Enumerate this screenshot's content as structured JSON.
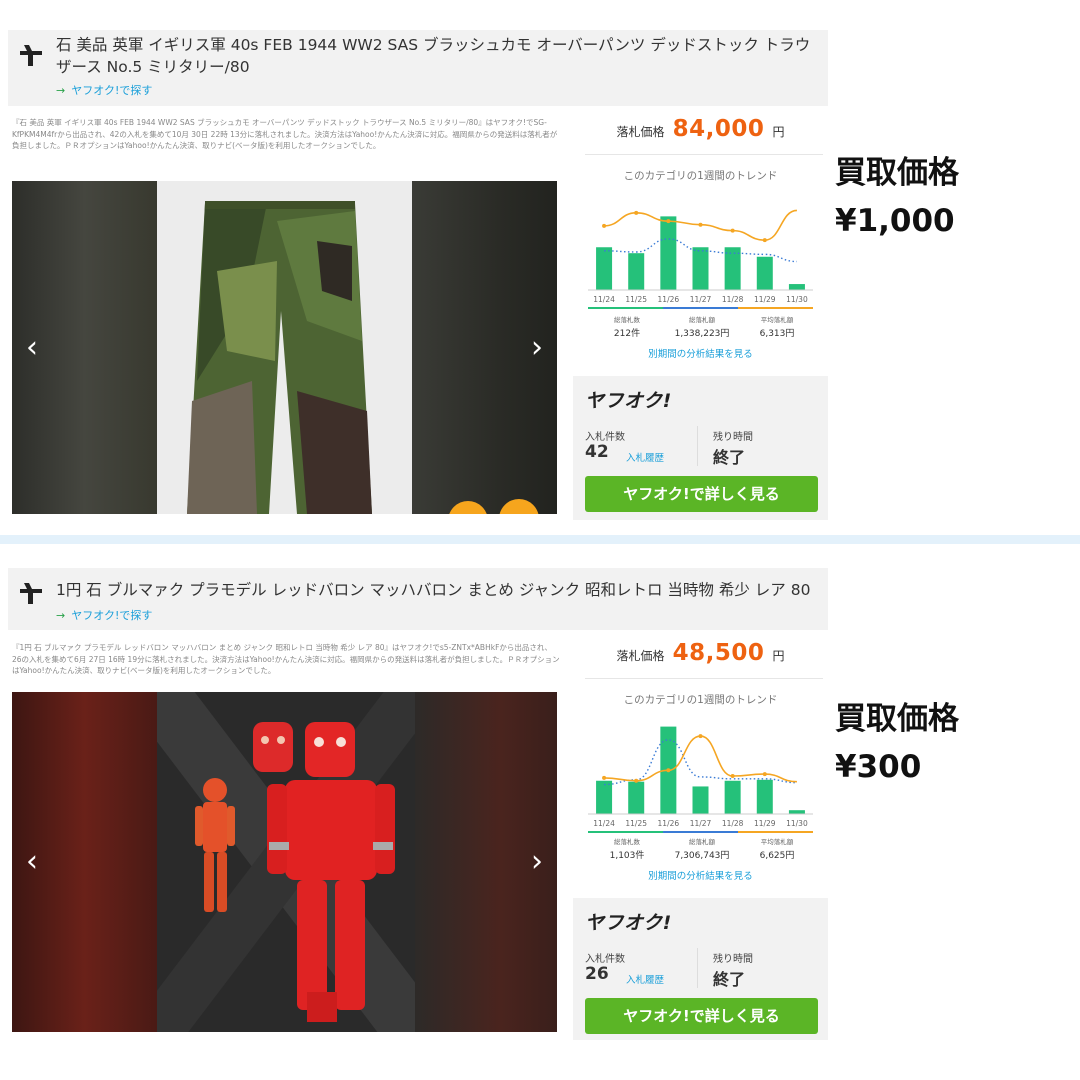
{
  "listings": [
    {
      "title": "石 美品 英軍 イギリス軍 40s FEB 1944 WW2 SAS ブラッシュカモ オーバーパンツ デッドストック トラウザース No.5 ミリタリー/80",
      "search_link": "ヤフオク!で探す",
      "description": "『石 美品 英軍 イギリス軍 40s FEB 1944 WW2 SAS ブラッシュカモ オーバーパンツ デッドストック トラウザース No.5 ミリタリー/80』はヤフオク!でSG-KfPKM4M4frから出品され、42の入札を集めて10月 30日 22時 13分に落札されました。決済方法はYahoo!かんたん決済に対応。福岡県からの発送料は落札者が負担しました。ＰＲオプションはYahoo!かんたん決済、取りナビ(ベータ版)を利用したオークションでした。",
      "price_label": "落札価格",
      "price_value": "84,000",
      "price_unit": "円",
      "trend_title": "このカテゴリの1週間のトレンド",
      "stats": [
        {
          "label": "総落札数",
          "value": "212件"
        },
        {
          "label": "総落札額",
          "value": "1,338,223円"
        },
        {
          "label": "平均落札額",
          "value": "6,313円"
        }
      ],
      "analysis_link": "別期間の分析結果を見る",
      "yahoo_logo": "ヤフオク!",
      "bid_count_label": "入札件数",
      "bid_count": "42",
      "bid_history": "入札履歴",
      "remaining_label": "残り時間",
      "remaining_value": "終了",
      "detail_button": "ヤフオク!で詳しく見る",
      "buyback_label": "買取価格",
      "buyback_price": "¥1,000",
      "chart_data": {
        "type": "bar",
        "categories": [
          "11/24",
          "11/25",
          "11/26",
          "11/27",
          "11/28",
          "11/29",
          "11/30"
        ],
        "series": [
          {
            "kind": "bar",
            "values": [
              36,
              31,
              62,
              36,
              36,
              28,
              5
            ]
          },
          {
            "kind": "line",
            "values": [
              54,
              65,
              58,
              55,
              50,
              42,
              67
            ]
          },
          {
            "kind": "dotted",
            "values": [
              33,
              32,
              43,
              33,
              31,
              30,
              24
            ]
          }
        ],
        "colors": {
          "bar": "#25c17a",
          "line": "#f5a623",
          "dotted": "#3a7bd5"
        },
        "ylim": [
          0,
          80
        ]
      }
    },
    {
      "title": "1円 石 ブルマァク プラモデル レッドバロン マッハバロン まとめ ジャンク 昭和レトロ 当時物 希少 レア 80",
      "search_link": "ヤフオク!で探す",
      "description": "『1円 石 ブルマァク プラモデル レッドバロン マッハバロン まとめ ジャンク 昭和レトロ 当時物 希少 レア 80』はヤフオク!でs5-ZNTx*ABHkFから出品され、26の入札を集めて6月 27日 16時 19分に落札されました。決済方法はYahoo!かんたん決済に対応。福岡県からの発送料は落札者が負担しました。ＰＲオプションはYahoo!かんたん決済、取りナビ(ベータ版)を利用したオークションでした。",
      "price_label": "落札価格",
      "price_value": "48,500",
      "price_unit": "円",
      "trend_title": "このカテゴリの1週間のトレンド",
      "stats": [
        {
          "label": "総落札数",
          "value": "1,103件"
        },
        {
          "label": "総落札額",
          "value": "7,306,743円"
        },
        {
          "label": "平均落札額",
          "value": "6,625円"
        }
      ],
      "analysis_link": "別期間の分析結果を見る",
      "yahoo_logo": "ヤフオク!",
      "bid_count_label": "入札件数",
      "bid_count": "26",
      "bid_history": "入札履歴",
      "remaining_label": "残り時間",
      "remaining_value": "終了",
      "detail_button": "ヤフオク!で詳しく見る",
      "buyback_label": "買取価格",
      "buyback_price": "¥300",
      "chart_data": {
        "type": "bar",
        "categories": [
          "11/24",
          "11/25",
          "11/26",
          "11/27",
          "11/28",
          "11/29",
          "11/30"
        ],
        "series": [
          {
            "kind": "bar",
            "values": [
              35,
              34,
              92,
              29,
              35,
              36,
              4
            ]
          },
          {
            "kind": "line",
            "values": [
              38,
              35,
              46,
              82,
              40,
              42,
              34
            ]
          },
          {
            "kind": "dotted",
            "values": [
              31,
              36,
              78,
              39,
              37,
              37,
              33
            ]
          }
        ],
        "colors": {
          "bar": "#25c17a",
          "line": "#f5a623",
          "dotted": "#3a7bd5"
        },
        "ylim": [
          0,
          100
        ]
      }
    }
  ],
  "icons": {
    "logo": "yahoo-auction-logo-icon",
    "prev": "chevron-left-icon",
    "next": "chevron-right-icon"
  }
}
